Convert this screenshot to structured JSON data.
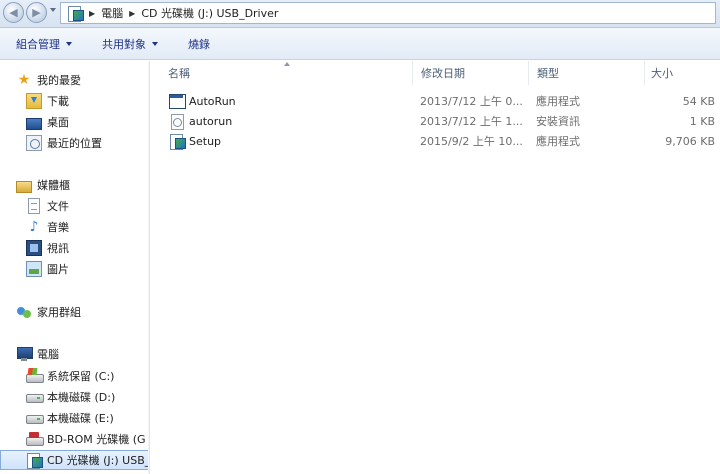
{
  "address": {
    "path": [
      "電腦",
      "CD 光碟機 (J:) USB_Driver"
    ]
  },
  "toolbar": {
    "organize": "組合管理",
    "share": "共用對象",
    "burn": "燒錄"
  },
  "nav": {
    "favorites": {
      "label": "我的最愛",
      "items": [
        "下載",
        "桌面",
        "最近的位置"
      ]
    },
    "libraries": {
      "label": "媒體櫃",
      "items": [
        "文件",
        "音樂",
        "視訊",
        "圖片"
      ]
    },
    "homegroup": "家用群組",
    "computer": {
      "label": "電腦",
      "drives": [
        "系統保留 (C:)",
        "本機磁碟 (D:)",
        "本機磁碟 (E:)",
        "BD-ROM 光碟機 (G",
        "CD 光碟機 (J:) USB_"
      ]
    }
  },
  "columns": {
    "name": "名稱",
    "date": "修改日期",
    "type": "類型",
    "size": "大小"
  },
  "files": [
    {
      "name": "AutoRun",
      "date": "2013/7/12 上午 0...",
      "type": "應用程式",
      "size": "54 KB",
      "icon": "autorun-app-icon"
    },
    {
      "name": "autorun",
      "date": "2013/7/12 上午 1...",
      "type": "安裝資訊",
      "size": "1 KB",
      "icon": "setup-info-icon"
    },
    {
      "name": "Setup",
      "date": "2015/9/2 上午 10...",
      "type": "應用程式",
      "size": "9,706 KB",
      "icon": "setup-app-icon"
    }
  ]
}
